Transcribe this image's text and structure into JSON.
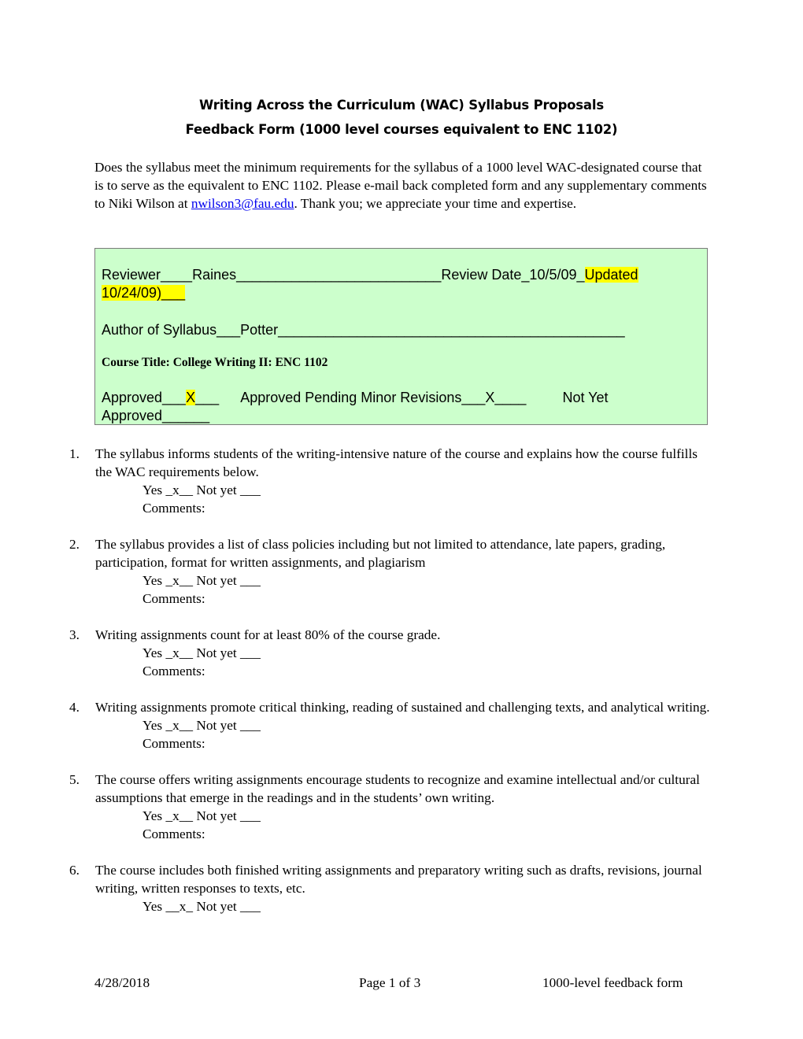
{
  "header": {
    "title_line1": "Writing Across the Curriculum (WAC) Syllabus Proposals",
    "title_line2": "Feedback Form (1000 level courses equivalent to ENC 1102)"
  },
  "intro": {
    "text_before_link": "Does the syllabus meet the minimum requirements for the syllabus of a 1000 level WAC-designated course that is to serve as the equivalent to ENC 1102. Please e-mail back completed form and any supplementary comments to Niki Wilson at ",
    "link_text": "nwilson3@fau.edu",
    "text_after_link": ".  Thank you; we appreciate your time and expertise."
  },
  "review_box": {
    "reviewer_text": "Reviewer____Raines__________________________Review Date_10/5/09_",
    "updated_highlight": "Updated 10/24/09)___",
    "author_text": "Author of Syllabus___Potter____________________________________________",
    "course_title": "Course Title:  College Writing II:  ENC 1102",
    "approved_label": "Approved___",
    "approved_mark": "X",
    "approved_tail": "___",
    "pending_text": "Approved Pending Minor Revisions___X____",
    "not_yet_text": "Not Yet Approved______",
    "highlight_color": "#ffff00",
    "background_color": "#ccffcc"
  },
  "criteria": [
    {
      "num": "1.",
      "text": "The syllabus informs students of the writing-intensive nature of the course and explains how the course fulfills the WAC requirements below.",
      "answer": "Yes _x__  Not yet ___",
      "comments": "Comments:"
    },
    {
      "num": "2.",
      "text": "The syllabus provides a list of class policies including but not limited to attendance, late papers, grading, participation, format for written assignments, and plagiarism",
      "answer": "Yes _x__  Not yet ___",
      "comments": "Comments:"
    },
    {
      "num": "3.",
      "text": "Writing assignments count for at least 80% of the course grade.",
      "answer": "Yes _x__ Not yet ___",
      "comments": "Comments:"
    },
    {
      "num": "4.",
      "text": "Writing assignments promote critical thinking, reading of sustained and challenging texts, and analytical writing.",
      "answer": "Yes _x__ Not yet ___",
      "comments": "Comments:"
    },
    {
      "num": "5.",
      "text": "The course offers writing assignments encourage students to recognize and examine intellectual and/or cultural assumptions that emerge in the readings and in the students’ own writing.",
      "answer": "Yes _x__ Not yet ___",
      "comments": "Comments:"
    },
    {
      "num": "6.",
      "text": "The course includes both finished writing assignments and preparatory writing such as drafts, revisions, journal writing, written responses to texts, etc.",
      "answer": "Yes __x_ Not yet ___"
    }
  ],
  "footer": {
    "date": "4/28/2018",
    "page": "Page 1 of 3",
    "doc_name": "1000-level feedback form"
  }
}
